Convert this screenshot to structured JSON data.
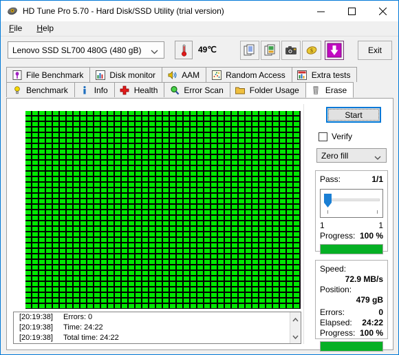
{
  "window": {
    "title": "HD Tune Pro 5.70 - Hard Disk/SSD Utility (trial version)",
    "icon": "hard-disk-icon",
    "minimize": "—",
    "maximize": "□",
    "close": "✕"
  },
  "menu": {
    "items": [
      {
        "label": "File",
        "mnemonic": "F"
      },
      {
        "label": "Help",
        "mnemonic": "H"
      }
    ]
  },
  "toolbar": {
    "drive": {
      "selected": "Lenovo SSD SL700 480G (480 gB)",
      "options": [
        "Lenovo SSD SL700 480G (480 gB)"
      ]
    },
    "temperature": "49℃",
    "temperature_icon": "thermometer-icon",
    "buttons": [
      {
        "name": "copy-text-icon",
        "tooltip": "Copy text"
      },
      {
        "name": "copy-image-icon",
        "tooltip": "Copy image"
      },
      {
        "name": "screenshot-camera-icon",
        "tooltip": "Screenshot"
      },
      {
        "name": "donate-money-icon",
        "tooltip": "Donate"
      },
      {
        "name": "download-arrow-icon",
        "tooltip": "Download"
      }
    ],
    "exit_label": "Exit"
  },
  "tabs": {
    "row1": [
      {
        "label": "File Benchmark",
        "icon": "file-benchmark-icon",
        "active": false
      },
      {
        "label": "Disk monitor",
        "icon": "bar-chart-icon",
        "active": false
      },
      {
        "label": "AAM",
        "icon": "speaker-icon",
        "active": false
      },
      {
        "label": "Random Access",
        "icon": "scatter-icon",
        "active": false
      },
      {
        "label": "Extra tests",
        "icon": "extra-tests-icon",
        "active": false
      }
    ],
    "row2": [
      {
        "label": "Benchmark",
        "icon": "lightbulb-icon",
        "active": false
      },
      {
        "label": "Info",
        "icon": "info-icon",
        "active": false
      },
      {
        "label": "Health",
        "icon": "red-cross-icon",
        "active": false
      },
      {
        "label": "Error Scan",
        "icon": "magnifier-icon",
        "active": false
      },
      {
        "label": "Folder Usage",
        "icon": "folder-icon",
        "active": false
      },
      {
        "label": "Erase",
        "icon": "trash-icon",
        "active": true
      }
    ]
  },
  "erase_panel": {
    "start_label": "Start",
    "verify_label": "Verify",
    "verify_checked": false,
    "fill_mode": {
      "selected": "Zero fill",
      "options": [
        "Zero fill"
      ]
    },
    "pass": {
      "label": "Pass:",
      "value": "1/1",
      "slider_min_label": "1",
      "slider_max_label": "1",
      "slider_position_percent": 0
    },
    "pass_progress": {
      "label": "Progress:",
      "value": "100 %",
      "percent": 100
    },
    "stats": {
      "speed_label": "Speed:",
      "speed_value": "72.9 MB/s",
      "position_label": "Position:",
      "position_value": "479 gB",
      "errors_label": "Errors:",
      "errors_value": "0",
      "elapsed_label": "Elapsed:",
      "elapsed_value": "24:22",
      "progress_label": "Progress:",
      "progress_value": "100 %",
      "progress_percent": 100
    }
  },
  "blockmap": {
    "columns": 40,
    "rows": 36,
    "block_color": "#00e800",
    "grid_line_color": "#000000",
    "filled_blocks": 1440
  },
  "log": {
    "entries": [
      {
        "time": "[20:19:38]",
        "text": "Errors: 0"
      },
      {
        "time": "[20:19:38]",
        "text": "Time: 24:22"
      },
      {
        "time": "[20:19:38]",
        "text": "Total time: 24:22"
      }
    ],
    "scroll_up": "∧",
    "scroll_down": "∨"
  },
  "colors": {
    "accent": "#0078d7",
    "progress_green": "#06b025",
    "block_green": "#00e800",
    "window_bg": "#f0f0f0"
  }
}
